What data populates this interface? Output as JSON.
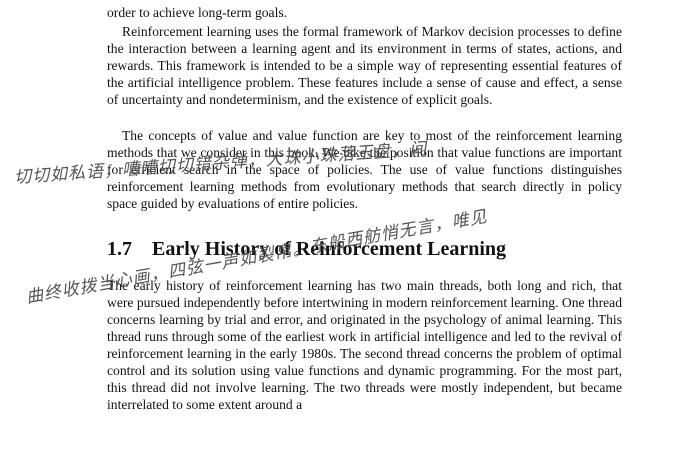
{
  "page": {
    "paragraphs": [
      "order to achieve long-term goals.",
      "Reinforcement learning uses the formal framework of Markov decision processes to define the interaction between a learning agent and its environment in terms of states, actions, and rewards. This framework is intended to be a simple way of representing essential features of the artificial intelligence problem. These features include a sense of cause and effect, a sense of uncertainty and nondeterminism, and the existence of explicit goals.",
      "The concepts of value and value function are key to most of the reinforcement learning methods that we consider in this book. We take the position that value functions are important for efficient search in the space of policies. The use of value functions distinguishes reinforcement learning methods from evolutionary methods that search directly in policy space guided by evaluations of entire policies.",
      "The early history of reinforcement learning has two main threads, both long and rich, that were pursued independently before intertwining in modern reinforcement learning. One thread concerns learning by trial and error, and originated in the psychology of animal learning. This thread runs through some of the earliest work in artificial intelligence and led to the revival of reinforcement learning in the early 1980s. The second thread concerns the problem of optimal control and its solution using value functions and dynamic programming. For the most part, this thread did not involve learning. The two threads were mostly independent, but became interrelated to some extent around a"
    ],
    "section": {
      "number": "1.7",
      "title": "Early History of Reinforcement Learning"
    },
    "handwriting": [
      "切切如私语，嘈嘈切切错杂弹，大珠小珠落玉盘，间",
      "曲终收拨当心画，四弦一声如裂帛。东船西舫悄无言，唯见"
    ]
  }
}
